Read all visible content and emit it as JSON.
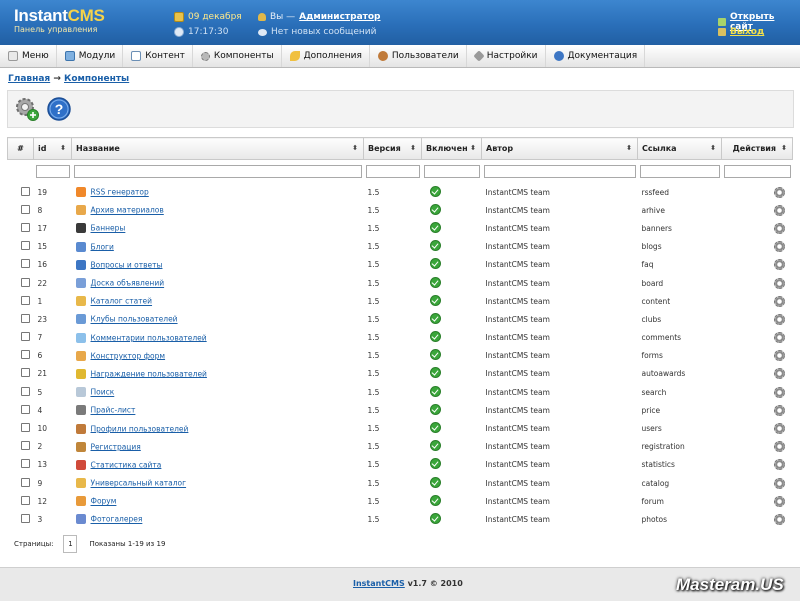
{
  "header": {
    "logo_main": "Instant",
    "logo_accent": "CMS",
    "subtitle": "Панель управления",
    "date": "09 декабря",
    "time": "17:17:30",
    "user_prefix": "Вы — ",
    "user_name": "Администратор",
    "messages": "Нет новых сообщений",
    "open_site": "Открыть сайт",
    "logout": "Выход"
  },
  "menu": {
    "items": [
      {
        "label": "Меню",
        "icon": "menu-icon"
      },
      {
        "label": "Модули",
        "icon": "modules-icon"
      },
      {
        "label": "Контент",
        "icon": "content-icon"
      },
      {
        "label": "Компоненты",
        "icon": "components-icon"
      },
      {
        "label": "Дополнения",
        "icon": "addons-icon"
      },
      {
        "label": "Пользователи",
        "icon": "users-icon"
      },
      {
        "label": "Настройки",
        "icon": "settings-icon"
      },
      {
        "label": "Документация",
        "icon": "docs-icon"
      }
    ]
  },
  "breadcrumb": {
    "home": "Главная",
    "separator": "→",
    "current": "Компоненты"
  },
  "table": {
    "columns": [
      "#",
      "id",
      "Название",
      "Версия",
      "Включен",
      "Автор",
      "Ссылка",
      "Действия"
    ],
    "rows": [
      {
        "id": "19",
        "name": "RSS генератор",
        "version": "1.5",
        "author": "InstantCMS team",
        "link": "rssfeed",
        "icon_color": "#f0882a"
      },
      {
        "id": "8",
        "name": "Архив материалов",
        "version": "1.5",
        "author": "InstantCMS team",
        "link": "arhive",
        "icon_color": "#e8a84a"
      },
      {
        "id": "17",
        "name": "Баннеры",
        "version": "1.5",
        "author": "InstantCMS team",
        "link": "banners",
        "icon_color": "#3a3a3a"
      },
      {
        "id": "15",
        "name": "Блоги",
        "version": "1.5",
        "author": "InstantCMS team",
        "link": "blogs",
        "icon_color": "#5a8ad0"
      },
      {
        "id": "16",
        "name": "Вопросы и ответы",
        "version": "1.5",
        "author": "InstantCMS team",
        "link": "faq",
        "icon_color": "#3d76c4"
      },
      {
        "id": "22",
        "name": "Доска объявлений",
        "version": "1.5",
        "author": "InstantCMS team",
        "link": "board",
        "icon_color": "#7a9fd8"
      },
      {
        "id": "1",
        "name": "Каталог статей",
        "version": "1.5",
        "author": "InstantCMS team",
        "link": "content",
        "icon_color": "#e8b84a"
      },
      {
        "id": "23",
        "name": "Клубы пользователей",
        "version": "1.5",
        "author": "InstantCMS team",
        "link": "clubs",
        "icon_color": "#6a9ad6"
      },
      {
        "id": "7",
        "name": "Комментарии пользователей",
        "version": "1.5",
        "author": "InstantCMS team",
        "link": "comments",
        "icon_color": "#8cc0ea"
      },
      {
        "id": "6",
        "name": "Конструктор форм",
        "version": "1.5",
        "author": "InstantCMS team",
        "link": "forms",
        "icon_color": "#e8a84a"
      },
      {
        "id": "21",
        "name": "Награждение пользователей",
        "version": "1.5",
        "author": "InstantCMS team",
        "link": "autoawards",
        "icon_color": "#e0b830"
      },
      {
        "id": "5",
        "name": "Поиск",
        "version": "1.5",
        "author": "InstantCMS team",
        "link": "search",
        "icon_color": "#b8c8d8"
      },
      {
        "id": "4",
        "name": "Прайс-лист",
        "version": "1.5",
        "author": "InstantCMS team",
        "link": "price",
        "icon_color": "#7a7a7a"
      },
      {
        "id": "10",
        "name": "Профили пользователей",
        "version": "1.5",
        "author": "InstantCMS team",
        "link": "users",
        "icon_color": "#c07a3a"
      },
      {
        "id": "2",
        "name": "Регистрация",
        "version": "1.5",
        "author": "InstantCMS team",
        "link": "registration",
        "icon_color": "#c0863a"
      },
      {
        "id": "13",
        "name": "Статистика сайта",
        "version": "1.5",
        "author": "InstantCMS team",
        "link": "statistics",
        "icon_color": "#d04a3a"
      },
      {
        "id": "9",
        "name": "Универсальный каталог",
        "version": "1.5",
        "author": "InstantCMS team",
        "link": "catalog",
        "icon_color": "#e8b84a"
      },
      {
        "id": "12",
        "name": "Форум",
        "version": "1.5",
        "author": "InstantCMS team",
        "link": "forum",
        "icon_color": "#e89a3a"
      },
      {
        "id": "3",
        "name": "Фотогалерея",
        "version": "1.5",
        "author": "InstantCMS team",
        "link": "photos",
        "icon_color": "#6a8ad0"
      }
    ]
  },
  "pager": {
    "label": "Страницы:",
    "current_page": "1",
    "summary": "Показаны 1-19 из 19"
  },
  "footer": {
    "brand": "InstantCMS",
    "version": "v1.7 © 2010"
  },
  "watermark": "Masteram.US",
  "colors": {
    "header_bg": "#2a6fb9",
    "link": "#1a5fa8",
    "enabled": "#3aa63a"
  }
}
